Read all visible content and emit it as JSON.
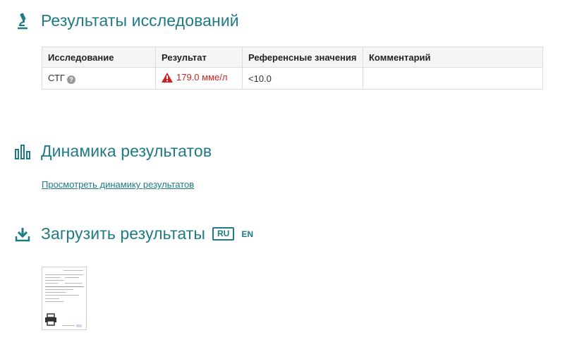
{
  "results_section": {
    "title": "Результаты исследований",
    "table": {
      "headers": [
        "Исследование",
        "Результат",
        "Референсные значения",
        "Комментарий"
      ],
      "rows": [
        {
          "test": "СТГ",
          "result": "179.0 мме/л",
          "reference": "<10.0",
          "comment": ""
        }
      ]
    }
  },
  "dynamics_section": {
    "title": "Динамика результатов",
    "link": "Просмотреть динамику результатов"
  },
  "download_section": {
    "title": "Загрузить результаты",
    "languages": [
      "RU",
      "EN"
    ]
  },
  "colors": {
    "accent": "#1e7a85",
    "alert": "#cc2222"
  },
  "icons": [
    "microscope-icon",
    "bar-chart-icon",
    "download-icon",
    "help-icon",
    "warning-icon",
    "print-icon"
  ]
}
